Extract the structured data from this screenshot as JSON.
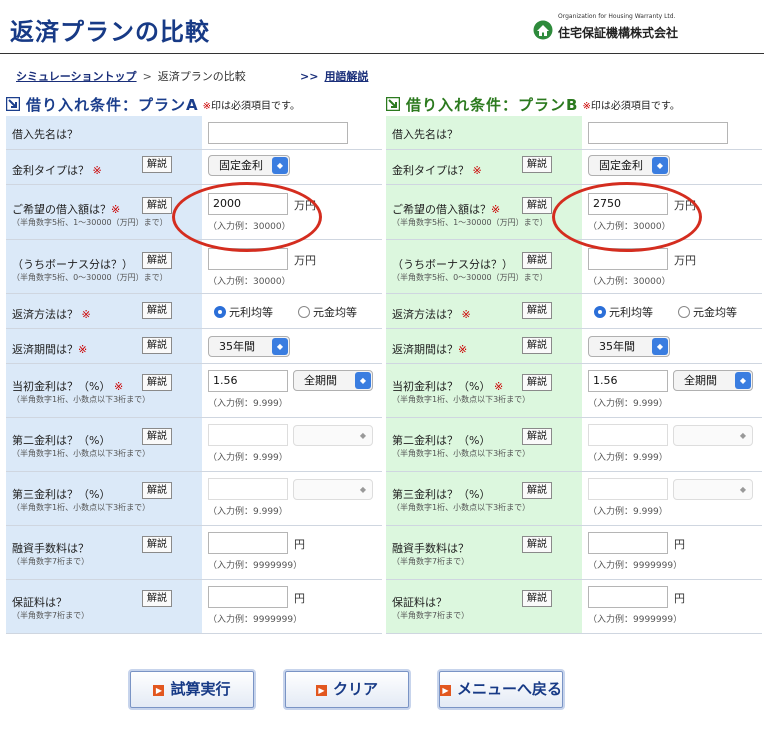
{
  "header": {
    "title": "返済プランの比較",
    "org_small": "Organization for Housing Warranty Ltd.",
    "org_name": "住宅保証機構株式会社"
  },
  "breadcrumb": {
    "home": "シミュレーショントップ",
    "separator": ">",
    "current": "返済プランの比較",
    "glossary_arrow": ">>",
    "glossary": "用語解説"
  },
  "note": {
    "mark": "※",
    "text": "印は必須項目です。"
  },
  "common": {
    "help": "解説",
    "required_mark": "※",
    "unit_man_yen": "万円",
    "unit_yen": "円"
  },
  "labels": {
    "lender": "借入先名は？",
    "rate_type": "金利タイプは？",
    "amount": "ご希望の借入額は？",
    "amount_sub": "（半角数字5桁、1〜30000（万円）まで）",
    "amount_hint": "（入力例：30000）",
    "bonus": "（うちボーナス分は？）",
    "bonus_sub": "（半角数字5桁、0〜30000（万円）まで）",
    "bonus_hint": "（入力例：30000）",
    "method": "返済方法は？",
    "method_opt1": "元利均等",
    "method_opt2": "元金均等",
    "period": "返済期間は？",
    "rate1": "当初金利は？（%）",
    "rate_sub": "（半角数字1桁、小数点以下3桁まで）",
    "rate_hint": "（入力例：9.999）",
    "rate2": "第二金利は？（%）",
    "rate3": "第三金利は？（%）",
    "fee": "融資手数料は？",
    "fee_sub": "（半角数字7桁まで）",
    "fee_hint": "（入力例：9999999）",
    "guarantee": "保証料は？"
  },
  "plan_a": {
    "heading": "借り入れ条件：プランA",
    "lender": "",
    "rate_type": "固定金利",
    "amount": "2000",
    "bonus": "",
    "method_selected": "元利均等",
    "period": "35年間",
    "rate1": "1.56",
    "rate1_period": "全期間",
    "rate2": "",
    "rate3": "",
    "fee": "",
    "guarantee": ""
  },
  "plan_b": {
    "heading": "借り入れ条件：プランB",
    "lender": "",
    "rate_type": "固定金利",
    "amount": "2750",
    "bonus": "",
    "method_selected": "元利均等",
    "period": "35年間",
    "rate1": "1.56",
    "rate1_period": "全期間",
    "rate2": "",
    "rate3": "",
    "fee": "",
    "guarantee": ""
  },
  "buttons": {
    "run": "試算実行",
    "clear": "クリア",
    "menu": "メニューへ戻る"
  },
  "icons": {
    "header_a": "checkbox-arrow-icon",
    "header_b": "checkbox-arrow-icon",
    "button": "arrow-right-icon"
  },
  "colors": {
    "title": "#173a86",
    "plan_a_label_bg": "#dbe9f8",
    "plan_b_label_bg": "#dcf7de",
    "required": "#cc0000",
    "highlight_circle": "#d42d1f"
  }
}
